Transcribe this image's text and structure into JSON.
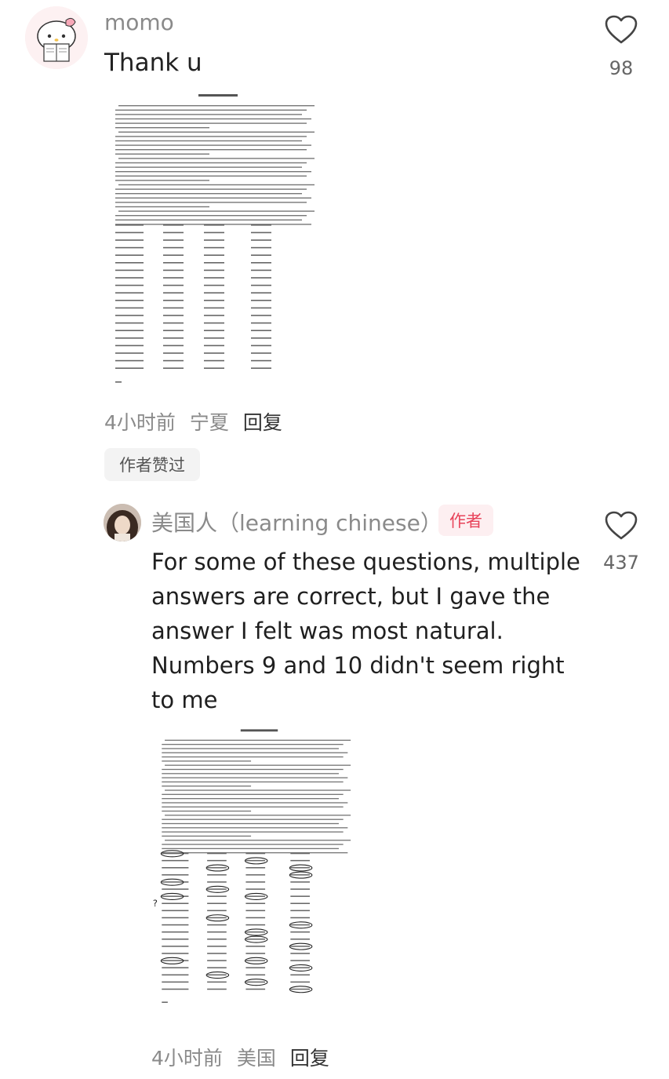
{
  "comments": [
    {
      "username": "momo",
      "text": "Thank u",
      "likes": "98",
      "time": "4小时前",
      "location": "宁夏",
      "reply": "回复",
      "liked_by_author": "作者赞过"
    },
    {
      "username": "美国人（learning chinese）",
      "badge": "作者",
      "text_lines": [
        "For some of these questions, multiple",
        "answers are correct, but I gave the",
        "answer I felt was most natural.",
        "Numbers 9 and 10 didn't seem right",
        "to me"
      ],
      "likes": "437",
      "time": "4小时前",
      "location": "美国",
      "reply": "回复"
    }
  ],
  "icons": [
    "heart-outline-icon",
    "hello-kitty-avatar",
    "user-photo-avatar"
  ],
  "colors": {
    "meta_text": "#8a8a8a",
    "author_badge_text": "#e8435a",
    "author_badge_bg": "#fdeff1",
    "chip_bg": "#f3f3f3"
  }
}
